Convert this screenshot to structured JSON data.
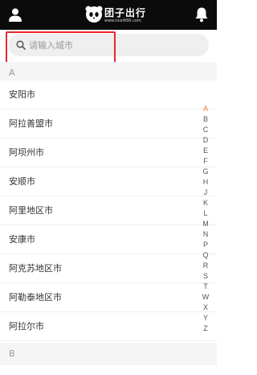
{
  "header": {
    "logo_text": "团子出行",
    "logo_url": "www.tuizi666.com",
    "user_icon": "user-icon",
    "bell_icon": "bell-icon"
  },
  "search": {
    "placeholder": "请输入城市"
  },
  "sections": [
    {
      "letter": "A",
      "cities": [
        "安阳市",
        "阿拉善盟市",
        "阿坝州市",
        "安顺市",
        "阿里地区市",
        "安康市",
        "阿克苏地区市",
        "阿勒泰地区市",
        "阿拉尔市"
      ]
    },
    {
      "letter": "B"
    }
  ],
  "index": {
    "active": "A",
    "letters": [
      "A",
      "B",
      "C",
      "D",
      "E",
      "F",
      "G",
      "H",
      "J",
      "K",
      "L",
      "M",
      "N",
      "P",
      "Q",
      "R",
      "S",
      "T",
      "W",
      "X",
      "Y",
      "Z"
    ]
  },
  "colors": {
    "accent": "#f07d2d",
    "annotation": "#e8282b",
    "topbar": "#0b0b0b"
  }
}
